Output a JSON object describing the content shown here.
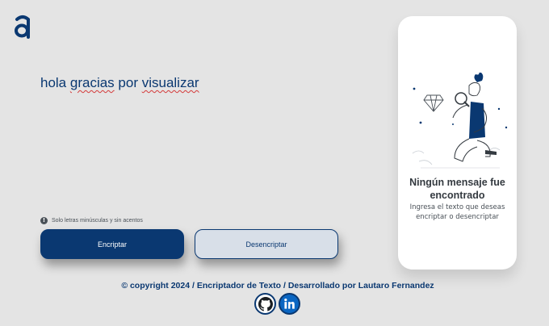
{
  "textarea": {
    "value_plain_1": "hola ",
    "value_error_1": "gracias",
    "value_plain_2": " por ",
    "value_error_2": "visualizar"
  },
  "hint": {
    "icon": "!",
    "text": "Solo letras minúsculas y sin acentos"
  },
  "buttons": {
    "encrypt_label": "Encriptar",
    "decrypt_label": "Desencriptar"
  },
  "output_panel": {
    "title": "Ningún mensaje fue encontrado",
    "message": "Ingresa el texto que deseas encriptar o desencriptar"
  },
  "footer": {
    "copyright": "© copyright 2024 / Encriptador de Texto / Desarrollado por Lautaro Fernandez"
  },
  "socials": [
    {
      "icon": "github-icon"
    },
    {
      "icon": "linkedin-icon"
    }
  ],
  "colors": {
    "primary": "#0a3871",
    "background": "#e4e4e4",
    "decrypt_bg": "#d8dfe8"
  }
}
